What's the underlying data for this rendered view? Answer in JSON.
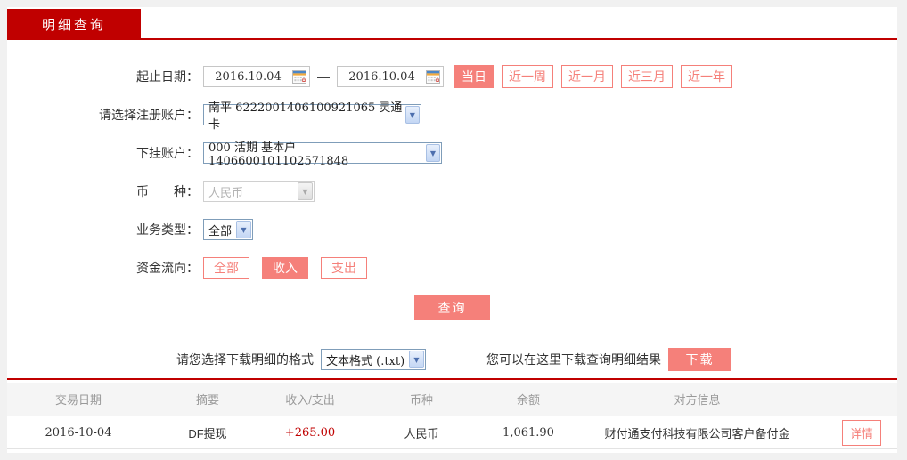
{
  "tab": {
    "label": "明细查询"
  },
  "form": {
    "date_range": {
      "label": "起止日期：",
      "start": "2016.10.04",
      "end": "2016.10.04",
      "separator": "—",
      "quick_buttons": [
        {
          "label": "当日",
          "active": true
        },
        {
          "label": "近一周",
          "active": false
        },
        {
          "label": "近一月",
          "active": false
        },
        {
          "label": "近三月",
          "active": false
        },
        {
          "label": "近一年",
          "active": false
        }
      ]
    },
    "register_account": {
      "label": "请选择注册账户：",
      "value": "南平 6222001406100921065 灵通卡"
    },
    "sub_account": {
      "label": "下挂账户：",
      "value": "000 活期 基本户 1406600101102571848"
    },
    "currency": {
      "label": "币　　种：",
      "value": "人民币",
      "disabled": true
    },
    "business_type": {
      "label": "业务类型：",
      "value": "全部"
    },
    "fund_direction": {
      "label": "资金流向：",
      "options": [
        {
          "label": "全部",
          "active": false
        },
        {
          "label": "收入",
          "active": true
        },
        {
          "label": "支出",
          "active": false
        }
      ]
    },
    "query_button": "查询"
  },
  "download": {
    "format_label": "请您选择下载明细的格式",
    "format_value": "文本格式 (.txt)",
    "hint": "您可以在这里下载查询明细结果",
    "button": "下载"
  },
  "table": {
    "headers": [
      "交易日期",
      "摘要",
      "收入/支出",
      "币种",
      "余额",
      "对方信息"
    ],
    "rows": [
      {
        "date": "2016-10-04",
        "summary": "DF提现",
        "amount": "+265.00",
        "currency": "人民币",
        "balance": "1,061.90",
        "counterparty": "财付通支付科技有限公司客户备付金",
        "detail_button": "详情"
      }
    ]
  },
  "colors": {
    "accent_red": "#c00000",
    "salmon": "#f5807a",
    "amount_red": "#c00000",
    "header_text": "#999999",
    "body_text": "#333333"
  }
}
